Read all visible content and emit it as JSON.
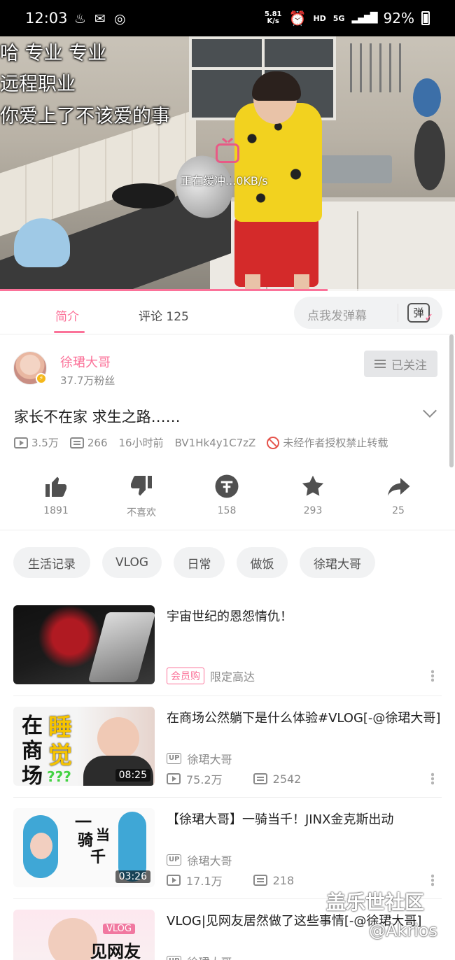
{
  "status_bar": {
    "time": "12:03",
    "net_speed_value": "5.81",
    "net_speed_unit": "K/s",
    "hd": "HD",
    "network": "5G",
    "battery": "92%"
  },
  "video": {
    "overlay_lines": [
      "哈    专业 专业",
      "远程职业",
      "你爱上了不该爱的事"
    ],
    "buffering_text": "正在缓冲...0KB/s",
    "progress_fraction": 0.72
  },
  "tabs": [
    {
      "label": "简介"
    },
    {
      "label": "评论 125"
    }
  ],
  "danmaku": {
    "placeholder": "点我发弹幕",
    "icon_char": "弹"
  },
  "uploader": {
    "name": "徐珺大哥",
    "fans": "37.7万粉丝",
    "follow_label": "已关注"
  },
  "video_info": {
    "title": "家长不在家 求生之路……",
    "views": "3.5万",
    "danmaku_count": "266",
    "time_ago": "16小时前",
    "bvid": "BV1Hk4y1C7zZ",
    "copyright_notice": "未经作者授权禁止转载"
  },
  "actions": [
    {
      "icon": "thumbs-up-icon",
      "label": "1891"
    },
    {
      "icon": "thumbs-down-icon",
      "label": "不喜欢"
    },
    {
      "icon": "coin-icon",
      "label": "158"
    },
    {
      "icon": "star-icon",
      "label": "293"
    },
    {
      "icon": "share-icon",
      "label": "25"
    }
  ],
  "tags": [
    "生活记录",
    "VLOG",
    "日常",
    "做饭",
    "徐珺大哥"
  ],
  "related": [
    {
      "title": "宇宙世纪的恩怨情仇！",
      "badge": "会员购",
      "subtitle": "限定高达"
    },
    {
      "title": "在商场公然躺下是什么体验#VLOG[-@徐珺大哥]",
      "author": "徐珺大哥",
      "views": "75.2万",
      "danmaku": "2542",
      "duration": "08:25",
      "thumb_text": [
        "在",
        "睡",
        "商",
        "觉",
        "场",
        "???"
      ]
    },
    {
      "title": "【徐珺大哥】一骑当千！JINX金克斯出动",
      "author": "徐珺大哥",
      "views": "17.1万",
      "danmaku": "218",
      "duration": "03:26",
      "thumb_text": [
        "一",
        "骑",
        "当",
        "千"
      ]
    },
    {
      "title": "VLOG|见网友居然做了这些事情[-@徐珺大哥]",
      "author": "徐珺大哥",
      "thumb_text": [
        "VLOG",
        "见网友"
      ]
    }
  ],
  "watermark": {
    "line1": "盖乐世社区",
    "line2": "@Akrios"
  },
  "colors": {
    "accent": "#fb7299",
    "text": "#212121",
    "muted": "#8a8a8a"
  }
}
